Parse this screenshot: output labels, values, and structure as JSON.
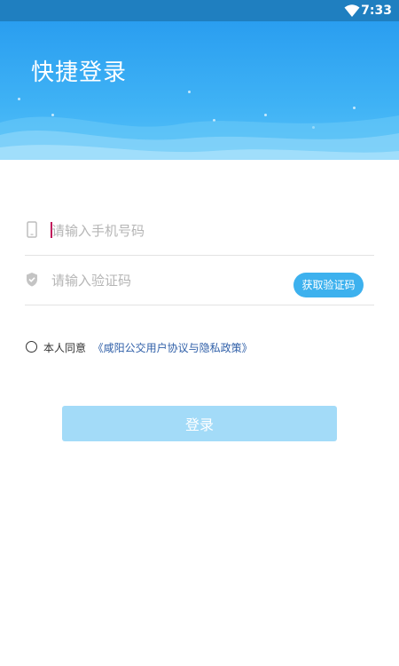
{
  "status_bar": {
    "time": "7:33"
  },
  "header": {
    "title": "快捷登录"
  },
  "form": {
    "phone": {
      "placeholder": "请输入手机号码",
      "value": ""
    },
    "code": {
      "placeholder": "请输入验证码",
      "value": ""
    },
    "get_code_label": "获取验证码"
  },
  "agreement": {
    "prefix": "本人同意",
    "link": "《咸阳公交用户协议与隐私政策》",
    "checked": false
  },
  "login_label": "登录",
  "colors": {
    "accent": "#3db1ee",
    "header_top": "#2a9ef0",
    "login_disabled": "#a3dbf8",
    "link": "#2f5fa8"
  },
  "icons": [
    "wifi-icon",
    "phone-icon",
    "shield-icon",
    "radio-icon"
  ]
}
